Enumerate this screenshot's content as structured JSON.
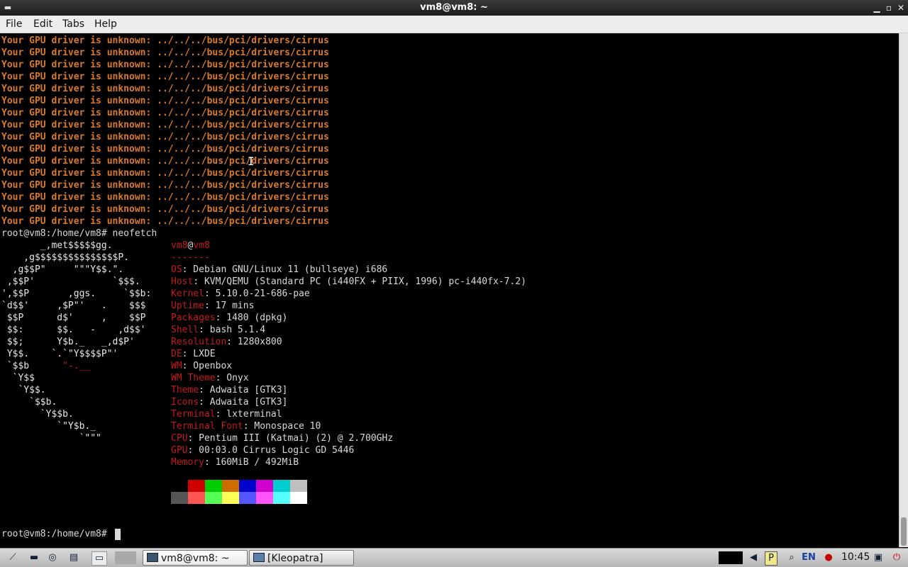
{
  "window": {
    "title": "vm8@vm8: ~",
    "controls": [
      "minimize-icon",
      "maximize-icon",
      "close-icon"
    ]
  },
  "menu": [
    "File",
    "Edit",
    "Tabs",
    "Help"
  ],
  "terminal": {
    "warning": "Your GPU driver is unknown: ../../../bus/pci/drivers/cirrus",
    "warning_count": 16,
    "command_prompt": "root@vm8:/home/vm8# neofetch",
    "final_prompt": "root@vm8:/home/vm8# ",
    "logo": [
      "       _,met$$$$$gg.",
      "    ,g$$$$$$$$$$$$$$$P.",
      "  ,g$$P\"     \"\"\"Y$$.\".",
      " ,$$P'              `$$$.",
      "',$$P       ,ggs.     `$$b:",
      "`d$$'     ,$P\"'   .    $$$",
      " $$P      d$'     ,    $$P",
      " $$:      $$.   -    ,d$$'",
      " $$;      Y$b._   _,d$P'",
      " Y$$.    `.`\"Y$$$$P\"'",
      " `$$b      \"-.__",
      "  `Y$$",
      "   `Y$$.",
      "     `$$b.",
      "       `Y$$b.",
      "          `\"Y$b._",
      "              `\"\"\""
    ],
    "user": "vm8",
    "at": "@",
    "host": "vm8",
    "separator": "-------",
    "info": [
      {
        "key": "OS",
        "value": "Debian GNU/Linux 11 (bullseye) i686"
      },
      {
        "key": "Host",
        "value": "KVM/QEMU (Standard PC (i440FX + PIIX, 1996) pc-i440fx-7.2)"
      },
      {
        "key": "Kernel",
        "value": "5.10.0-21-686-pae"
      },
      {
        "key": "Uptime",
        "value": "17 mins"
      },
      {
        "key": "Packages",
        "value": "1480 (dpkg)"
      },
      {
        "key": "Shell",
        "value": "bash 5.1.4"
      },
      {
        "key": "Resolution",
        "value": "1280x800"
      },
      {
        "key": "DE",
        "value": "LXDE"
      },
      {
        "key": "WM",
        "value": "Openbox"
      },
      {
        "key": "WM Theme",
        "value": "Onyx"
      },
      {
        "key": "Theme",
        "value": "Adwaita [GTK3]"
      },
      {
        "key": "Icons",
        "value": "Adwaita [GTK3]"
      },
      {
        "key": "Terminal",
        "value": "lxterminal"
      },
      {
        "key": "Terminal Font",
        "value": "Monospace 10"
      },
      {
        "key": "CPU",
        "value": "Pentium III (Katmai) (2) @ 2.700GHz"
      },
      {
        "key": "GPU",
        "value": "00:03.0 Cirrus Logic GD 5446"
      },
      {
        "key": "Memory",
        "value": "160MiB / 492MiB"
      }
    ],
    "palette_top": [
      "#000000",
      "#cd0000",
      "#00cd00",
      "#cd6d00",
      "#0000cd",
      "#cd00cd",
      "#00cdcd",
      "#bfbfbf"
    ],
    "palette_bottom": [
      "#555555",
      "#ff5555",
      "#55ff55",
      "#ffff55",
      "#5555ff",
      "#ff55ff",
      "#55ffff",
      "#ffffff"
    ],
    "colors": {
      "warning": "#d87a2a",
      "key": "#c41a1a",
      "text": "#d9d9d9"
    }
  },
  "taskbar": {
    "launchers": [
      "menu-icon",
      "desktop-icon",
      "browser-icon",
      "files-icon",
      "terminal-icon"
    ],
    "tasks": [
      {
        "label": "vm8@vm8: ~",
        "active": true
      },
      {
        "label": "[Kleopatra]",
        "active": false
      }
    ],
    "tray": [
      "volume-icon",
      "clipboard-icon",
      "search-icon"
    ],
    "language": "EN",
    "clock": "10:45"
  }
}
